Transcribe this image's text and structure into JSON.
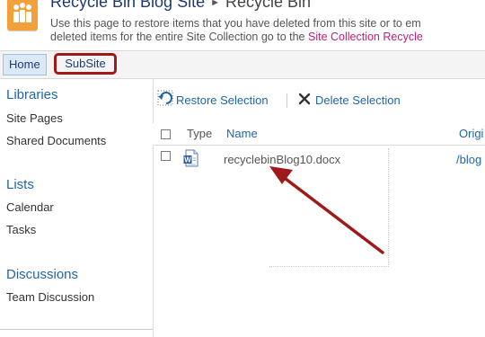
{
  "header": {
    "site_title": "Recycle Bin Blog Site",
    "page_title": "Recycle Bin",
    "description_line1": "Use this page to restore items that you have deleted from this site or to em",
    "description_line2_prefix": "deleted items for the entire Site Collection go to the ",
    "description_link": "Site Collection Recycle"
  },
  "topnav": {
    "home": "Home",
    "subsite": "SubSite"
  },
  "quicklaunch": {
    "libraries": {
      "heading": "Libraries",
      "items": [
        "Site Pages",
        "Shared Documents"
      ]
    },
    "lists": {
      "heading": "Lists",
      "items": [
        "Calendar",
        "Tasks"
      ]
    },
    "discussions": {
      "heading": "Discussions",
      "items": [
        "Team Discussion"
      ]
    }
  },
  "toolbar": {
    "restore": "Restore Selection",
    "delete": "Delete Selection"
  },
  "grid": {
    "columns": {
      "type": "Type",
      "name": "Name",
      "original": "Origi"
    },
    "rows": [
      {
        "name": "recyclebinBlog10.docx",
        "original": "/blog"
      }
    ]
  },
  "colors": {
    "accent_blue": "#1f66a8",
    "highlight_red": "#9e1a1a",
    "link_magenta": "#bd1e77",
    "site_icon_orange": "#f2a13a"
  }
}
